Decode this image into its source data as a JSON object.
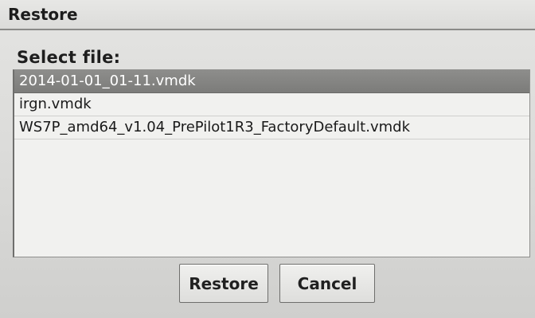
{
  "dialog": {
    "title": "Restore",
    "prompt": "Select file:"
  },
  "files": [
    {
      "name": "2014-01-01_01-11.vmdk",
      "selected": true
    },
    {
      "name": "irgn.vmdk",
      "selected": false
    },
    {
      "name": "WS7P_amd64_v1.04_PrePilot1R3_FactoryDefault.vmdk",
      "selected": false
    }
  ],
  "buttons": {
    "restore_label": "Restore",
    "cancel_label": "Cancel"
  },
  "colors": {
    "selection": "#828280",
    "list_background": "#f1f1ef",
    "dialog_background": "#dcdcda"
  }
}
